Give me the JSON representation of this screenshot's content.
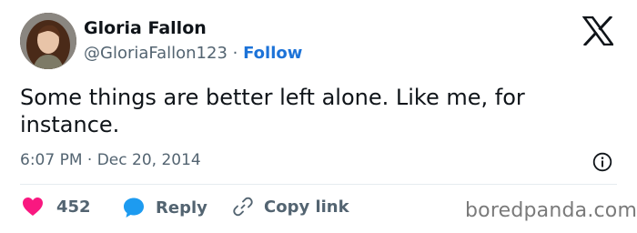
{
  "author": {
    "display_name": "Gloria Fallon",
    "handle": "@GloriaFallon123",
    "separator": "·",
    "follow_label": "Follow"
  },
  "tweet": {
    "text": "Some things are better left alone. Like me, for instance.",
    "time": "6:07 PM",
    "date_separator": "·",
    "date": "Dec 20, 2014"
  },
  "actions": {
    "like_count": "452",
    "reply_label": "Reply",
    "copy_link_label": "Copy link"
  },
  "icons": {
    "platform_logo": "x-logo-icon",
    "info": "info-icon",
    "like": "heart-icon",
    "reply": "speech-bubble-icon",
    "copy_link": "link-icon"
  },
  "watermark": "boredpanda.com",
  "colors": {
    "follow": "#1d73d8",
    "like": "#f91880",
    "reply": "#1d9bf0",
    "secondary_text": "#536471"
  }
}
